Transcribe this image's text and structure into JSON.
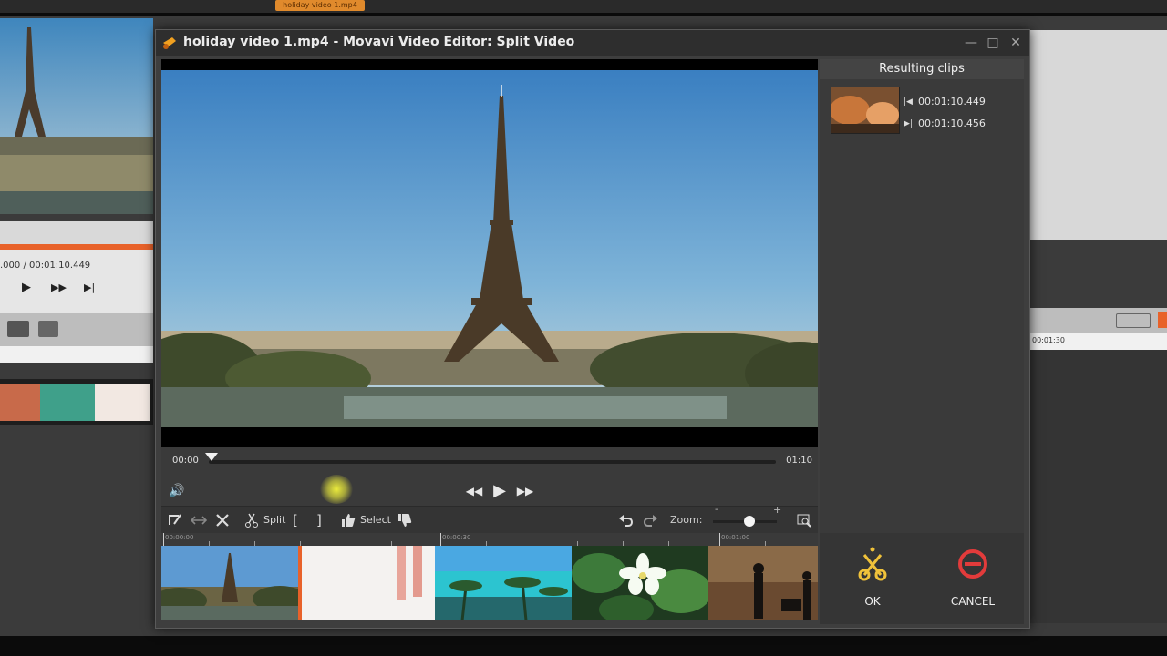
{
  "background_editor": {
    "tab_title": "holiday video 1.mp4",
    "timecode": ".000  / 00:01:10.449",
    "ruler_time": "00:01:30"
  },
  "dialog": {
    "title": "holiday video 1.mp4 - Movavi Video Editor: Split Video",
    "window_controls": {
      "minimize": "—",
      "maximize": "□",
      "close": "✕"
    }
  },
  "player": {
    "time_start": "00:00",
    "time_end": "01:10",
    "progress_fraction": 0.0
  },
  "toolbar": {
    "split_label": "Split",
    "select_label": "Select",
    "zoom_label": "Zoom:",
    "zoom_minus": "-",
    "zoom_plus": "+",
    "zoom_level_fraction": 0.5
  },
  "timeline": {
    "ruler_labels": [
      "00:00:00",
      "00:00:30",
      "00:01:00"
    ]
  },
  "resulting_clips": {
    "header": "Resulting clips",
    "clips": [
      {
        "start": "00:01:10.449",
        "end": "00:01:10.456"
      }
    ]
  },
  "actions": {
    "ok_label": "OK",
    "cancel_label": "CANCEL"
  },
  "colors": {
    "accent_orange": "#e8622a",
    "ok_icon": "#f0c23a",
    "cancel_icon": "#e23b3b",
    "dialog_bg": "#3e3e3e"
  }
}
